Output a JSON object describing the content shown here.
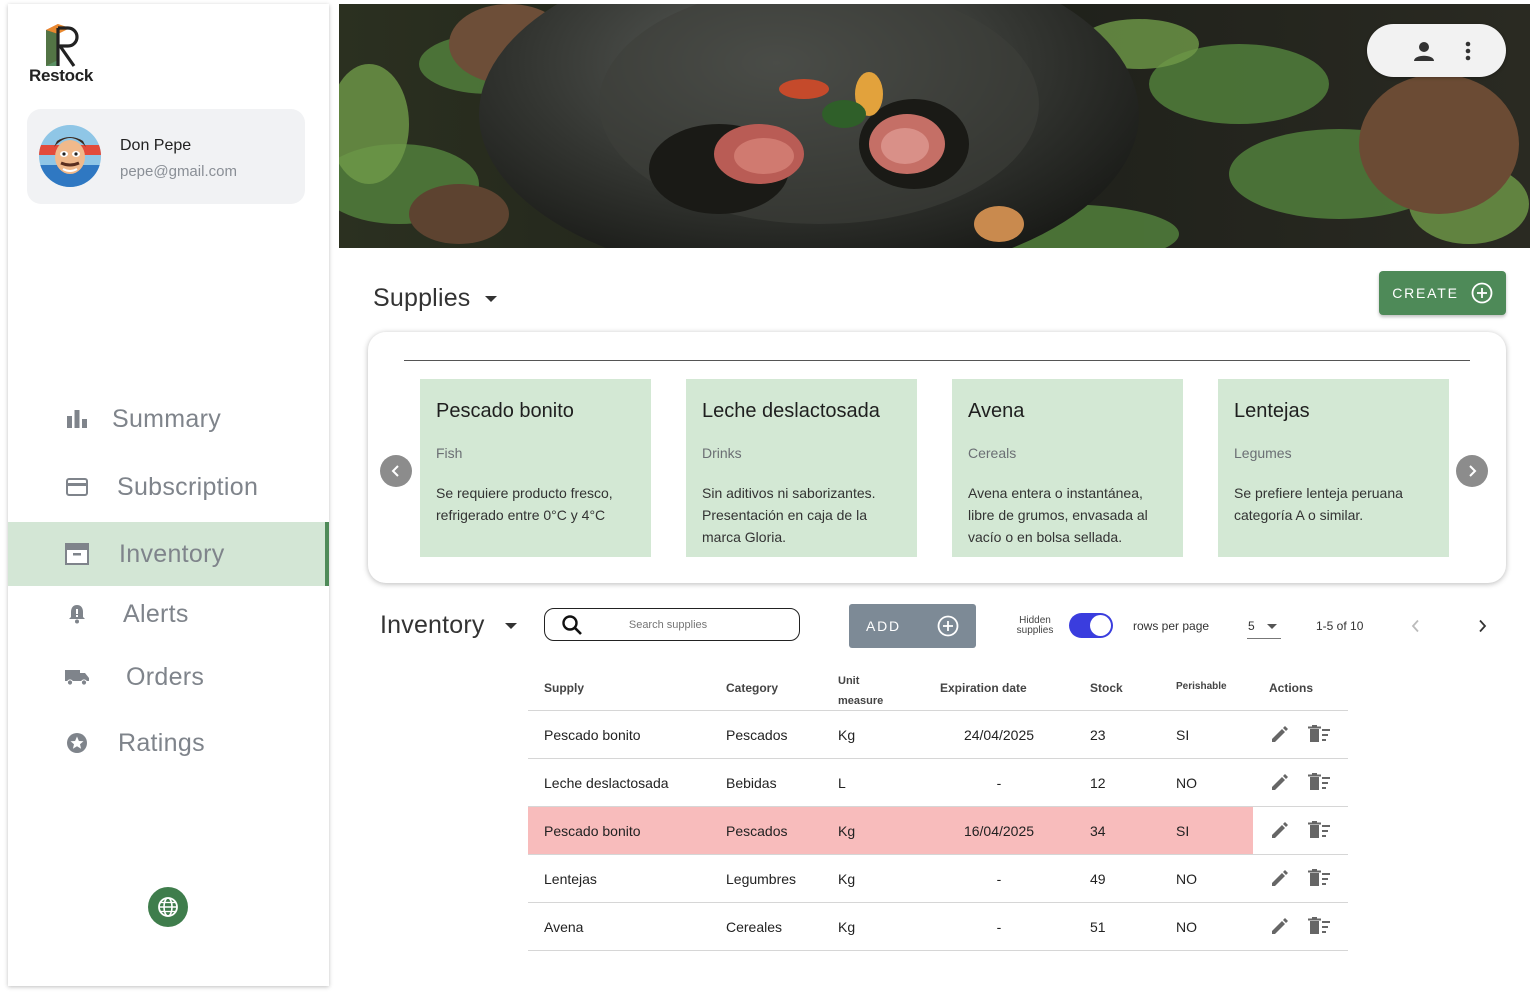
{
  "brand": {
    "name": "Restock"
  },
  "user": {
    "name": "Don Pepe",
    "email": "pepe@gmail.com"
  },
  "nav": {
    "items": [
      {
        "label": "Summary",
        "icon": "bar-chart-icon"
      },
      {
        "label": "Subscription",
        "icon": "credit-card-icon"
      },
      {
        "label": "Inventory",
        "icon": "archive-icon",
        "active": true
      },
      {
        "label": "Alerts",
        "icon": "bell-alert-icon"
      },
      {
        "label": "Orders",
        "icon": "truck-icon"
      },
      {
        "label": "Ratings",
        "icon": "star-circle-icon"
      }
    ]
  },
  "supplies": {
    "title": "Supplies",
    "create_label": "CREATE",
    "cards": [
      {
        "title": "Pescado bonito",
        "category": "Fish",
        "description": "Se requiere producto fresco, refrigerado entre 0°C y 4°C"
      },
      {
        "title": "Leche deslactosada",
        "category": "Drinks",
        "description": "Sin aditivos ni saborizantes. Presentación en caja de la marca Gloria."
      },
      {
        "title": "Avena",
        "category": "Cereals",
        "description": "Avena entera o instantánea, libre de grumos, envasada al vacío o en bolsa sellada."
      },
      {
        "title": "Lentejas",
        "category": "Legumes",
        "description": "Se prefiere lenteja peruana categoría A o similar."
      }
    ]
  },
  "inventory": {
    "title": "Inventory",
    "search_placeholder": "Search supplies",
    "add_label": "ADD",
    "hidden_label": "Hidden supplies",
    "rows_per_page_label": "rows per page",
    "rows_per_page": "5",
    "range": "1-5 of 10",
    "columns": [
      "Supply",
      "Category",
      "Unit measure",
      "Expiration date",
      "Stock",
      "Perishable",
      "Actions"
    ],
    "rows": [
      {
        "supply": "Pescado bonito",
        "category": "Pescados",
        "unit": "Kg",
        "expiration": "24/04/2025",
        "stock": "23",
        "perishable": "SI",
        "highlight": false
      },
      {
        "supply": "Leche deslactosada",
        "category": "Bebidas",
        "unit": "L",
        "expiration": "-",
        "stock": "12",
        "perishable": "NO",
        "highlight": false
      },
      {
        "supply": "Pescado bonito",
        "category": "Pescados",
        "unit": "Kg",
        "expiration": "16/04/2025",
        "stock": "34",
        "perishable": "SI",
        "highlight": true
      },
      {
        "supply": "Lentejas",
        "category": "Legumbres",
        "unit": "Kg",
        "expiration": "-",
        "stock": "49",
        "perishable": "NO",
        "highlight": false
      },
      {
        "supply": "Avena",
        "category": "Cereales",
        "unit": "Kg",
        "expiration": "-",
        "stock": "51",
        "perishable": "NO",
        "highlight": false
      }
    ]
  },
  "colors": {
    "accent": "#4e8a58",
    "card_bg": "#d3e8d4",
    "highlight_row": "#f8bcbc",
    "toggle": "#3a3dde"
  }
}
